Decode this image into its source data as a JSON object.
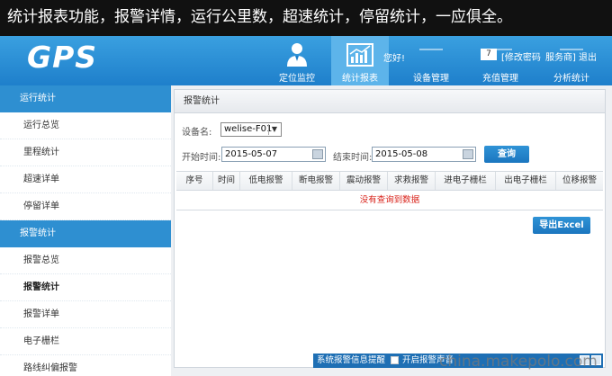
{
  "banner": {
    "text": "统计报表功能，报警详情，运行公里数，超速统计，停留统计，一应俱全。"
  },
  "header": {
    "logo": "GPS",
    "nav": [
      {
        "label": "定位监控",
        "icon": "person-icon"
      },
      {
        "label": "统计报表",
        "icon": "chart-report-icon"
      },
      {
        "label": "设备管理",
        "icon": "device-icon"
      },
      {
        "label": "充值管理",
        "icon": "recharge-icon"
      },
      {
        "label": "分析统计",
        "icon": "analysis-icon"
      }
    ],
    "greeting": "您好!",
    "user_badge": "7",
    "change_password": "[修改密码",
    "service_provider": "服务商]",
    "logout": "退出"
  },
  "sidebar": {
    "sections": [
      {
        "title": "运行统计",
        "items": [
          "运行总览",
          "里程统计",
          "超速详单",
          "停留详单"
        ]
      },
      {
        "title": "报警统计",
        "items": [
          "报警总览",
          "报警统计",
          "报警详单",
          "电子栅栏",
          "路线纠偏报警"
        ]
      }
    ],
    "active_item": "报警统计"
  },
  "panel": {
    "title": "报警统计",
    "device_label": "设备名:",
    "device_value": "welise-F01",
    "start_label": "开始时间:",
    "start_value": "2015-05-07",
    "end_label": "结束时间:",
    "end_value": "2015-05-08",
    "query_button": "查询",
    "columns": [
      "序号",
      "时间",
      "低电报警",
      "断电报警",
      "震动报警",
      "求救报警",
      "进电子栅栏",
      "出电子栅栏",
      "位移报警"
    ],
    "empty_text": "没有查询到数据",
    "export_button": "导出Excel"
  },
  "alert_bar": {
    "title": "系统报警信息提醒",
    "toggle_label": "开启报警声音",
    "toggle_checked": false
  },
  "watermark": "china.makepolo.com",
  "colors": {
    "header_blue": "#1e7fcb",
    "section_blue": "#2e8fd1",
    "empty_red": "#d9221a"
  }
}
